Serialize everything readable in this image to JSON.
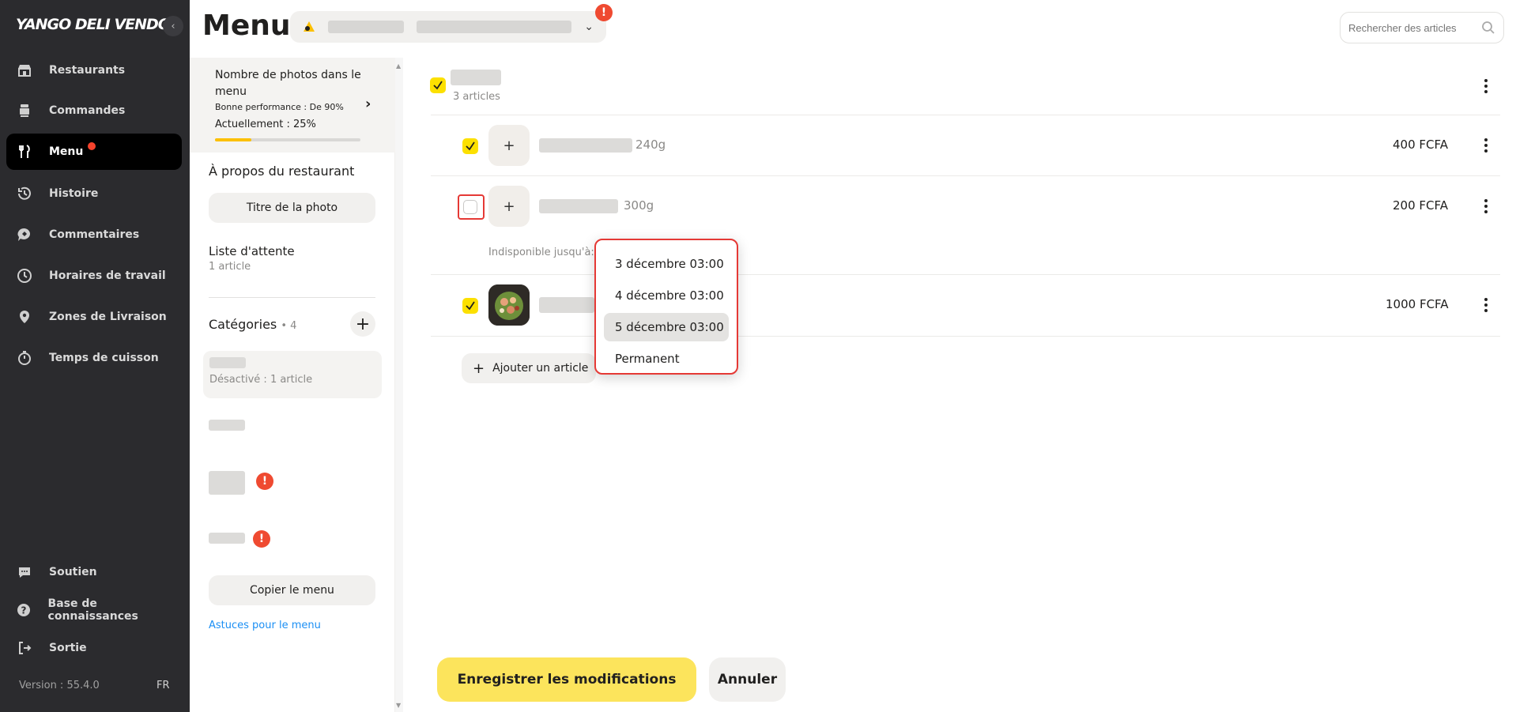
{
  "app": {
    "logo": "YANGO DELI VENDOR",
    "version": "Version : 55.4.0",
    "lang": "FR"
  },
  "sidebar": {
    "items": [
      {
        "label": "Restaurants",
        "icon": "store-icon"
      },
      {
        "label": "Commandes",
        "icon": "orders-icon"
      },
      {
        "label": "Menu",
        "icon": "fork-knife-icon",
        "active": true
      },
      {
        "label": "Histoire",
        "icon": "history-icon"
      },
      {
        "label": "Commentaires",
        "icon": "comments-icon"
      },
      {
        "label": "Horaires de travail",
        "icon": "clock-icon"
      },
      {
        "label": "Zones de Livraison",
        "icon": "location-pin-icon"
      },
      {
        "label": "Temps de cuisson",
        "icon": "timer-icon"
      }
    ],
    "bottom": [
      {
        "label": "Soutien",
        "icon": "chat-icon"
      },
      {
        "label": "Base de connaissances",
        "icon": "help-icon"
      },
      {
        "label": "Sortie",
        "icon": "logout-icon"
      }
    ]
  },
  "header": {
    "title": "Menu",
    "search_placeholder": "Rechercher des articles"
  },
  "photo_card": {
    "title": "Nombre de photos dans le menu",
    "good": "Bonne performance : De 90%",
    "current": "Actuellement : 25%",
    "progress_percent": 25
  },
  "about": {
    "title": "À propos du restaurant",
    "button": "Titre de la photo"
  },
  "waitlist": {
    "title": "Liste d'attente",
    "count": "1 article"
  },
  "categories": {
    "title": "Catégories",
    "count": "• 4",
    "first_sub": "Désactivé : 1 article"
  },
  "copy_button": "Copier le menu",
  "tips_link": "Astuces pour le menu",
  "group": {
    "count": "3 articles"
  },
  "items": [
    {
      "weight": "240g",
      "price": "400 FCFA",
      "checked": true
    },
    {
      "weight": "300g",
      "price": "200 FCFA",
      "checked": false,
      "unavailable": "Indisponible jusqu'à:"
    },
    {
      "weight": "",
      "price": "1000 FCFA",
      "checked": true
    }
  ],
  "add_article": "Ajouter un article",
  "dropdown": {
    "options": [
      "3 décembre 03:00",
      "4 décembre 03:00",
      "5 décembre 03:00",
      "Permanent"
    ],
    "selected": "5 décembre 03:00"
  },
  "actions": {
    "save": "Enregistrer les modifications",
    "cancel": "Annuler"
  },
  "colors": {
    "accent": "#fce000",
    "alert": "#ef4a31",
    "sidebar": "#2b2b2e",
    "link": "#1b8ff4"
  }
}
